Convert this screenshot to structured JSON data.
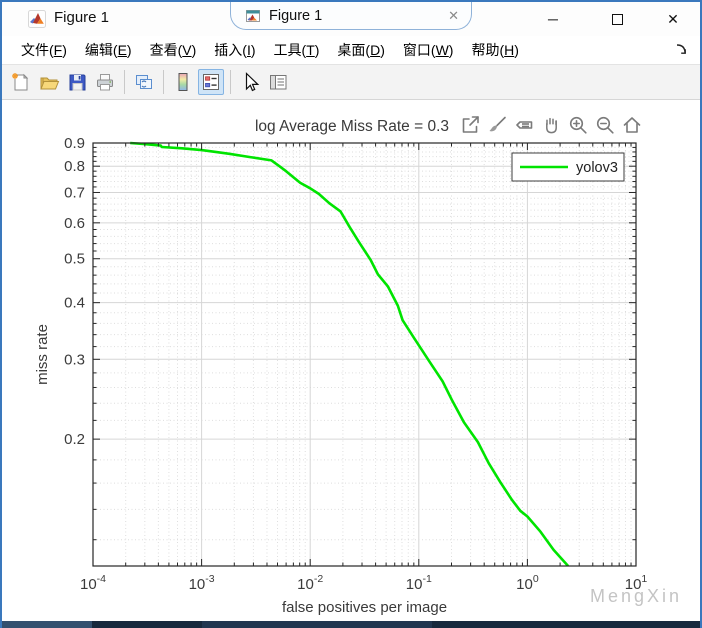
{
  "window": {
    "title": "Figure 1",
    "tab_title": "Figure 1",
    "tab_close": "✕",
    "controls": {
      "minimize": "─",
      "maximize": "",
      "close": "✕"
    }
  },
  "menu": {
    "items": [
      {
        "pre": "文件(",
        "key": "F",
        "post": ")"
      },
      {
        "pre": "编辑(",
        "key": "E",
        "post": ")"
      },
      {
        "pre": "查看(",
        "key": "V",
        "post": ")"
      },
      {
        "pre": "插入(",
        "key": "I",
        "post": ")"
      },
      {
        "pre": "工具(",
        "key": "T",
        "post": ")"
      },
      {
        "pre": "桌面(",
        "key": "D",
        "post": ")"
      },
      {
        "pre": "窗口(",
        "key": "W",
        "post": ")"
      },
      {
        "pre": "帮助(",
        "key": "H",
        "post": ")"
      }
    ]
  },
  "toolbar": {
    "icons": [
      "new-figure",
      "open-file",
      "save-figure",
      "print-figure",
      "link-plot",
      "insert-colorbar",
      "insert-legend",
      "edit-plot",
      "property-inspector"
    ],
    "active_icon": "insert-legend"
  },
  "axes_toolbar": {
    "icons": [
      "export",
      "brush",
      "datatips",
      "pan",
      "zoom-in",
      "zoom-out",
      "restore-view"
    ],
    "icon_color": "#7a7a7a"
  },
  "plot": {
    "watermark": "MengXin",
    "watermark_color": "#c4c4c4",
    "background": "#ffffff",
    "box_color": "#262626",
    "grid_major_color": "#d6d6d6",
    "grid_minor_color": "#dedede"
  },
  "chart_data": {
    "type": "line",
    "title": "log Average Miss Rate = 0.3",
    "xlabel": "false positives per image",
    "ylabel": "miss rate",
    "xscale": "log",
    "yscale": "log",
    "xlim": [
      0.0001,
      10
    ],
    "ylim": [
      0.105,
      0.9
    ],
    "x_tick_exponents": [
      -4,
      -3,
      -2,
      -1,
      0,
      1
    ],
    "y_ticks": [
      0.2,
      0.3,
      0.4,
      0.5,
      0.6,
      0.7,
      0.8,
      0.9
    ],
    "grid": true,
    "minor_grid": true,
    "legend_position": "northeast",
    "series": [
      {
        "name": "yolov3",
        "color": "#00e400",
        "points": [
          [
            0.00022,
            0.9
          ],
          [
            0.0003,
            0.895
          ],
          [
            0.00042,
            0.888
          ],
          [
            0.00043,
            0.882
          ],
          [
            0.00066,
            0.876
          ],
          [
            0.001,
            0.868
          ],
          [
            0.0014,
            0.859
          ],
          [
            0.0018,
            0.852
          ],
          [
            0.0028,
            0.838
          ],
          [
            0.0044,
            0.824
          ],
          [
            0.0052,
            0.8
          ],
          [
            0.006,
            0.78
          ],
          [
            0.0071,
            0.754
          ],
          [
            0.0081,
            0.735
          ],
          [
            0.01,
            0.715
          ],
          [
            0.012,
            0.695
          ],
          [
            0.015,
            0.663
          ],
          [
            0.019,
            0.636
          ],
          [
            0.023,
            0.588
          ],
          [
            0.028,
            0.545
          ],
          [
            0.036,
            0.497
          ],
          [
            0.042,
            0.462
          ],
          [
            0.052,
            0.434
          ],
          [
            0.064,
            0.394
          ],
          [
            0.071,
            0.366
          ],
          [
            0.092,
            0.332
          ],
          [
            0.126,
            0.296
          ],
          [
            0.166,
            0.268
          ],
          [
            0.2,
            0.245
          ],
          [
            0.26,
            0.218
          ],
          [
            0.35,
            0.197
          ],
          [
            0.44,
            0.177
          ],
          [
            0.56,
            0.161
          ],
          [
            0.72,
            0.147
          ],
          [
            0.86,
            0.139
          ],
          [
            1.0,
            0.135
          ],
          [
            1.32,
            0.125
          ],
          [
            1.74,
            0.114
          ],
          [
            2.37,
            0.105
          ]
        ]
      }
    ]
  }
}
